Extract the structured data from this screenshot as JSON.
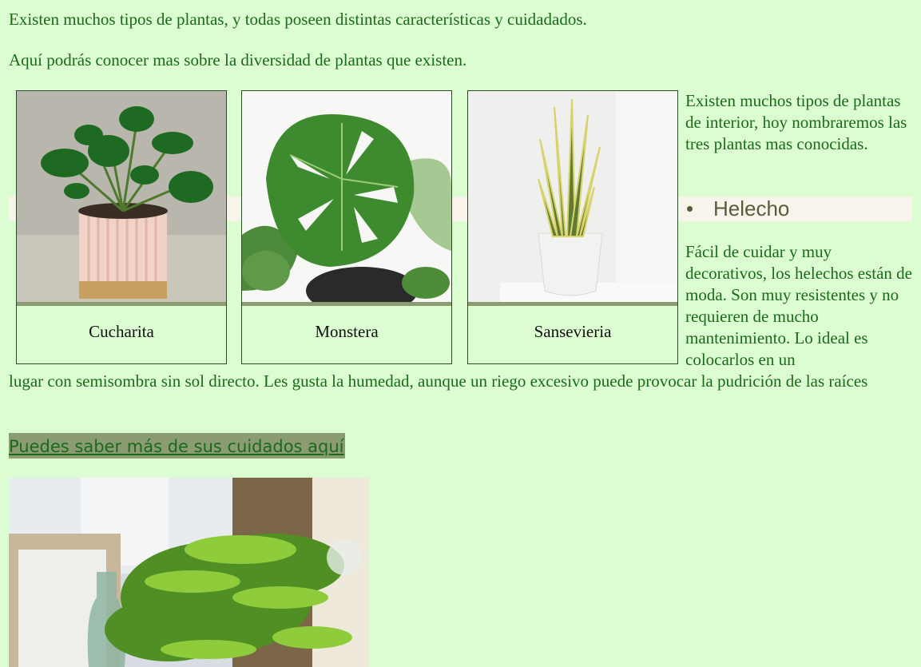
{
  "intro": {
    "line1": "Existen muchos tipos de plantas, y todas poseen distintas características y cuidadados.",
    "line2": "Aquí podrás conocer mas sobre la diversidad de plantas que existen."
  },
  "cards": [
    {
      "caption": "Cucharita"
    },
    {
      "caption": "Monstera"
    },
    {
      "caption": "Sansevieria"
    }
  ],
  "side": {
    "text": "Existen muchos tipos de plantas de interior, hoy nombraremos las tres plantas mas conocidas.",
    "list_item": "Helecho",
    "desc_part1": "Fácil de cuidar y muy decorativos, los helechos están de moda. Son muy resistentes y no requieren de mucho mantenimiento. Lo ideal es colocarlos en un",
    "desc_part2": "lugar con semisombra sin sol directo. Les gusta la humedad, aunque un riego excesivo puede provocar la pudrición de las raíces"
  },
  "link": {
    "label": "Puedes saber más de sus cuidados aquí"
  },
  "colors": {
    "background": "#dcfcd2",
    "text": "#1a6a1a",
    "band": "#f8f4ec",
    "accent": "#8b9c72"
  }
}
